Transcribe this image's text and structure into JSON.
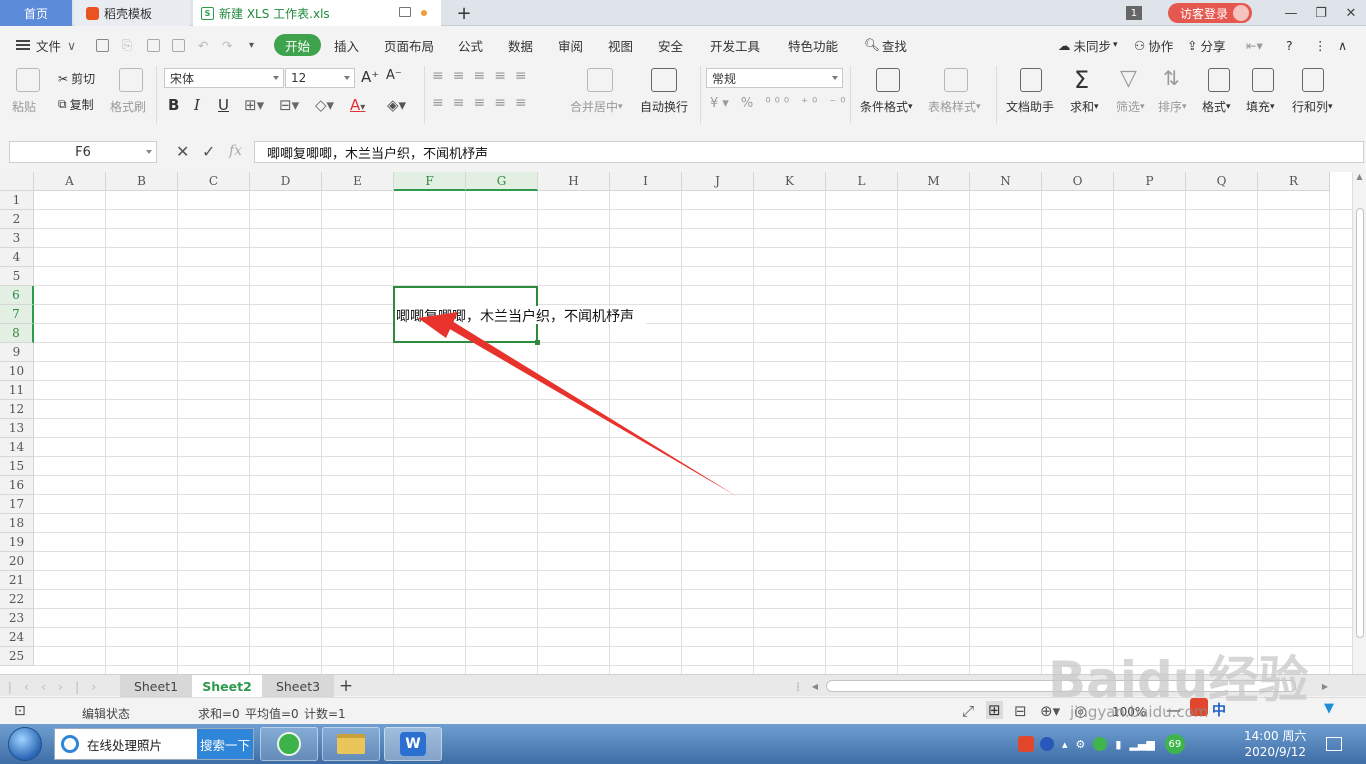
{
  "tabs": {
    "home": "首页",
    "template": "稻壳模板",
    "document": "新建 XLS 工作表.xls",
    "window_count": "1",
    "login": "访客登录"
  },
  "menu": {
    "file": "文件",
    "start": "开始",
    "items": [
      "插入",
      "页面布局",
      "公式",
      "数据",
      "审阅",
      "视图",
      "安全",
      "开发工具",
      "特色功能"
    ],
    "search": "查找",
    "sync": "未同步",
    "collab": "协作",
    "share": "分享"
  },
  "ribbon": {
    "paste": "粘贴",
    "cut": "剪切",
    "copy": "复制",
    "format_painter": "格式刷",
    "font_name": "宋体",
    "font_size": "12",
    "merge_center": "合并居中",
    "wrap_text": "自动换行",
    "number_format": "常规",
    "conditional_format": "条件格式",
    "table_style": "表格样式",
    "doc_helper": "文档助手",
    "sum": "求和",
    "filter": "筛选",
    "sort": "排序",
    "format": "格式",
    "fill": "填充",
    "row_col": "行和列"
  },
  "formula_bar": {
    "cell_ref": "F6",
    "fx": "fx",
    "content": "唧唧复唧唧，木兰当户织，不闻机杼声"
  },
  "grid": {
    "columns": [
      "A",
      "B",
      "C",
      "D",
      "E",
      "F",
      "G",
      "H",
      "I",
      "J",
      "K",
      "L",
      "M",
      "N",
      "O",
      "P",
      "Q",
      "R"
    ],
    "rows": [
      "1",
      "2",
      "3",
      "4",
      "5",
      "6",
      "7",
      "8",
      "9",
      "10",
      "11",
      "12",
      "13",
      "14",
      "15",
      "16",
      "17",
      "18",
      "19",
      "20",
      "21",
      "22",
      "23",
      "24",
      "25"
    ],
    "selected_columns": [
      "F",
      "G"
    ],
    "selected_rows": [
      "6",
      "7",
      "8"
    ],
    "cell_text": "唧唧复唧唧，木兰当户织，不闻机杼声"
  },
  "sheets": {
    "tabs": [
      "Sheet1",
      "Sheet2",
      "Sheet3"
    ],
    "active": "Sheet2"
  },
  "status": {
    "mode": "编辑状态",
    "sum": "求和=0",
    "average": "平均值=0",
    "count": "计数=1",
    "zoom": "100%"
  },
  "taskbar": {
    "search_text": "在线处理照片",
    "search_button": "搜索一下",
    "tray_number": "69",
    "time": "14:00 周六",
    "date": "2020/9/12",
    "ime": "中"
  },
  "watermark": {
    "logo": "Baidu经验",
    "url": "jingyan.baidu.com"
  },
  "colors": {
    "accent_green": "#2e9a4c",
    "home_tab": "#5b8bd8",
    "login": "#e5584f",
    "arrow": "#e8332c"
  }
}
